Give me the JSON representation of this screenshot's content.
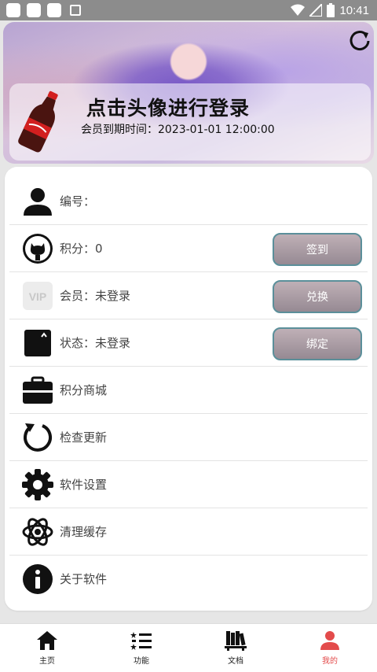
{
  "status_bar": {
    "time": "10:41"
  },
  "header": {
    "login_title": "点击头像进行登录",
    "expire_label": "会员到期时间：",
    "expire_value": "2023-01-01 12:00:00"
  },
  "list": {
    "id_label": "编号：",
    "id_value": "",
    "points_label": "积分：",
    "points_value": "0",
    "checkin_button": "签到",
    "vip_label": "会员：",
    "vip_value": "未登录",
    "vip_badge": "VIP",
    "redeem_button": "兑换",
    "status_label": "状态：",
    "status_value": "未登录",
    "bind_button": "绑定",
    "points_shop": "积分商城",
    "check_update": "检查更新",
    "settings": "软件设置",
    "clear_cache": "清理缓存",
    "about": "关于软件"
  },
  "bottom_nav": {
    "items": [
      {
        "label": "主页",
        "icon": "home-icon"
      },
      {
        "label": "功能",
        "icon": "list-icon"
      },
      {
        "label": "文档",
        "icon": "books-icon"
      },
      {
        "label": "我的",
        "icon": "user-icon",
        "active": true
      }
    ]
  },
  "colors": {
    "accent": "#e34b4b",
    "button": "#a79aa2"
  }
}
